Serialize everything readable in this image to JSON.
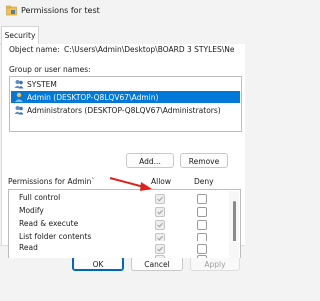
{
  "window": {
    "title": "Permissions for test"
  },
  "tabs": [
    {
      "label": "Security"
    }
  ],
  "object": {
    "label": "Object name:",
    "value": "C:\\Users\\Admin\\Desktop\\BOARD 3 STYLES\\Ne"
  },
  "groups": {
    "label": "Group or user names:",
    "items": [
      {
        "name": "SYSTEM",
        "icon": "users-icon",
        "selected": false
      },
      {
        "name": "Admin (DESKTOP-Q8LQV67\\Admin)",
        "icon": "user-icon",
        "selected": true
      },
      {
        "name": "Administrators (DESKTOP-Q8LQV67\\Administrators)",
        "icon": "users-icon",
        "selected": false
      }
    ]
  },
  "buttons": {
    "add": "Add...",
    "remove": "Remove",
    "ok": "OK",
    "cancel": "Cancel",
    "apply": "Apply"
  },
  "permissions": {
    "label": "Permissions for Admin`",
    "allow_header": "Allow",
    "deny_header": "Deny",
    "rows": [
      {
        "name": "Full control",
        "allow": true,
        "deny": false
      },
      {
        "name": "Modify",
        "allow": true,
        "deny": false
      },
      {
        "name": "Read & execute",
        "allow": true,
        "deny": false
      },
      {
        "name": "List folder contents",
        "allow": true,
        "deny": false
      },
      {
        "name": "Read",
        "allow": true,
        "deny": false
      },
      {
        "name": "",
        "allow": true,
        "deny": false
      }
    ]
  },
  "colors": {
    "selection": "#0078d7",
    "annotation_arrow": "#e0201b"
  }
}
